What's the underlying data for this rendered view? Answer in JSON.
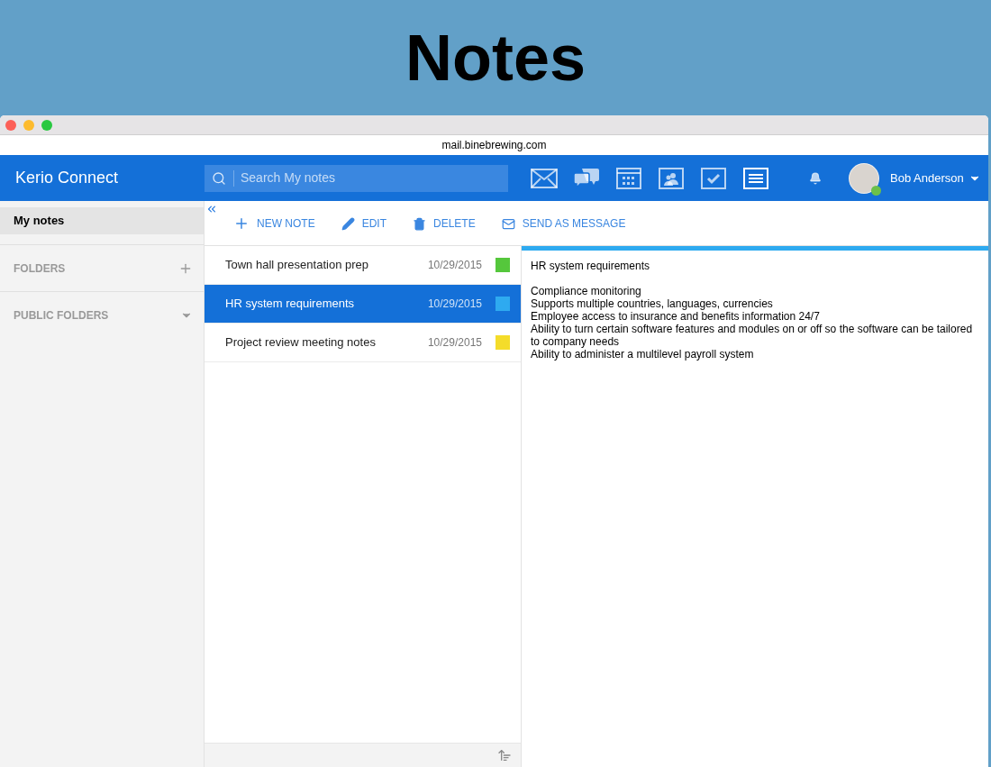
{
  "banner": {
    "title": "Notes"
  },
  "browser": {
    "address": "mail.binebrewing.com"
  },
  "header": {
    "brand": "Kerio Connect",
    "search": {
      "placeholder": "Search My notes"
    },
    "nav": [
      {
        "kind": "mail",
        "selected": false
      },
      {
        "kind": "chat",
        "selected": false
      },
      {
        "kind": "calendar",
        "selected": false
      },
      {
        "kind": "contacts",
        "selected": false
      },
      {
        "kind": "tasks",
        "selected": false
      },
      {
        "kind": "notes",
        "selected": true
      }
    ],
    "user": {
      "name": "Bob Anderson",
      "online": true
    }
  },
  "sidebar": {
    "items": [
      {
        "kind": "item",
        "label": "My notes",
        "selected": true
      },
      {
        "kind": "section_add",
        "label": "FOLDERS"
      },
      {
        "kind": "section_expand",
        "label": "PUBLIC FOLDERS"
      }
    ]
  },
  "toolbar": {
    "actions": [
      {
        "kind": "add",
        "label": "NEW NOTE"
      },
      {
        "kind": "edit",
        "label": "EDIT"
      },
      {
        "kind": "delete",
        "label": "DELETE"
      },
      {
        "kind": "send",
        "label": "SEND AS MESSAGE"
      }
    ]
  },
  "notes": [
    {
      "title": "Town hall presentation prep",
      "date": "10/29/2015",
      "color": "#55c73c",
      "selected": false
    },
    {
      "title": "HR system requirements",
      "date": "10/29/2015",
      "color": "#2eaaf0",
      "selected": true
    },
    {
      "title": "Project review meeting notes",
      "date": "10/29/2015",
      "color": "#f4dc2a",
      "selected": false
    }
  ],
  "note_view": {
    "title": "HR system requirements",
    "lines": [
      "Compliance monitoring",
      "Supports multiple countries, languages, currencies",
      "Employee access to insurance and benefits information 24/7",
      "Ability to turn certain software features and modules on or off so the software can be tailored to company needs",
      "Ability to administer a multilevel payroll system"
    ]
  }
}
